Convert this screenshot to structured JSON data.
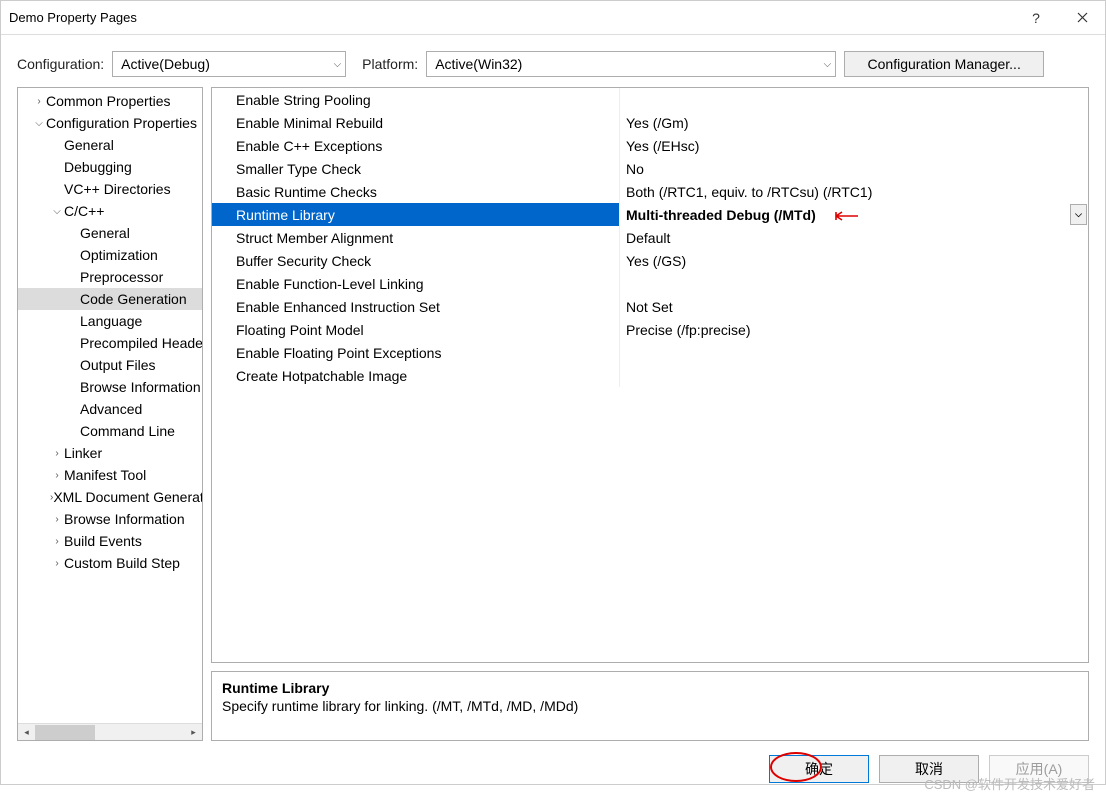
{
  "window": {
    "title": "Demo Property Pages"
  },
  "toolbar": {
    "config_label": "Configuration:",
    "config_value": "Active(Debug)",
    "platform_label": "Platform:",
    "platform_value": "Active(Win32)",
    "manager_label": "Configuration Manager..."
  },
  "tree": {
    "common": "Common Properties",
    "confprops": "Configuration Properties",
    "general": "General",
    "debugging": "Debugging",
    "vcdirs": "VC++ Directories",
    "ccpp": "C/C++",
    "cc_general": "General",
    "cc_opt": "Optimization",
    "cc_pre": "Preprocessor",
    "cc_codegen": "Code Generation",
    "cc_lang": "Language",
    "cc_pch": "Precompiled Headers",
    "cc_out": "Output Files",
    "cc_browse": "Browse Information",
    "cc_adv": "Advanced",
    "cc_cmd": "Command Line",
    "linker": "Linker",
    "manifest": "Manifest Tool",
    "xmldoc": "XML Document Generator",
    "browseinfo": "Browse Information",
    "buildev": "Build Events",
    "custom": "Custom Build Step"
  },
  "grid": [
    {
      "name": "Enable String Pooling",
      "value": ""
    },
    {
      "name": "Enable Minimal Rebuild",
      "value": "Yes (/Gm)"
    },
    {
      "name": "Enable C++ Exceptions",
      "value": "Yes (/EHsc)"
    },
    {
      "name": "Smaller Type Check",
      "value": "No"
    },
    {
      "name": "Basic Runtime Checks",
      "value": "Both (/RTC1, equiv. to /RTCsu) (/RTC1)"
    },
    {
      "name": "Runtime Library",
      "value": "Multi-threaded Debug (/MTd)",
      "selected": true
    },
    {
      "name": "Struct Member Alignment",
      "value": "Default"
    },
    {
      "name": "Buffer Security Check",
      "value": "Yes (/GS)"
    },
    {
      "name": "Enable Function-Level Linking",
      "value": ""
    },
    {
      "name": "Enable Enhanced Instruction Set",
      "value": "Not Set"
    },
    {
      "name": "Floating Point Model",
      "value": "Precise (/fp:precise)"
    },
    {
      "name": "Enable Floating Point Exceptions",
      "value": ""
    },
    {
      "name": "Create Hotpatchable Image",
      "value": ""
    }
  ],
  "desc": {
    "title": "Runtime Library",
    "text": "Specify runtime library for linking.     (/MT, /MTd, /MD, /MDd)"
  },
  "footer": {
    "ok": "确定",
    "cancel": "取消",
    "apply": "应用(A)"
  },
  "watermark": "CSDN @软件开发技术爱好者"
}
